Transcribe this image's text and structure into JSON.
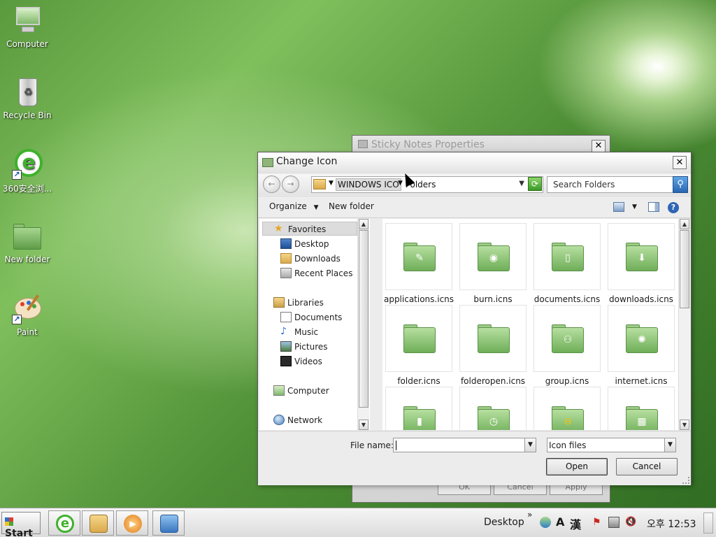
{
  "desktop": {
    "icons": [
      {
        "label": "Computer",
        "icon": "computer-icon"
      },
      {
        "label": "Recycle Bin",
        "icon": "recycle-bin-icon"
      },
      {
        "label": "360安全浏...",
        "icon": "browser-360-icon"
      },
      {
        "label": "New folder",
        "icon": "folder-icon"
      },
      {
        "label": "Paint",
        "icon": "paint-icon"
      }
    ]
  },
  "background_dialog": {
    "title": "Sticky Notes Properties",
    "ok_label": "OK",
    "cancel_label": "Cancel",
    "apply_label": "Apply"
  },
  "dialog": {
    "title": "Change Icon",
    "close_label": "✕",
    "address": {
      "segments": [
        "WINDOWS ICO",
        "Folders"
      ]
    },
    "search": {
      "placeholder": "Search Folders"
    },
    "toolbar": {
      "organize_label": "Organize",
      "new_folder_label": "New folder"
    },
    "nav": {
      "favorites_label": "Favorites",
      "favorites": [
        "Desktop",
        "Downloads",
        "Recent Places"
      ],
      "libraries_label": "Libraries",
      "libraries": [
        "Documents",
        "Music",
        "Pictures",
        "Videos"
      ],
      "computer_label": "Computer",
      "network_label": "Network"
    },
    "files": [
      {
        "name": "applications.icns",
        "glyph": "✎"
      },
      {
        "name": "burn.icns",
        "glyph": "◉"
      },
      {
        "name": "documents.icns",
        "glyph": "▯"
      },
      {
        "name": "downloads.icns",
        "glyph": "⬇"
      },
      {
        "name": "folder.icns",
        "glyph": ""
      },
      {
        "name": "folderopen.icns",
        "glyph": ""
      },
      {
        "name": "group.icns",
        "glyph": "⚇"
      },
      {
        "name": "internet.icns",
        "glyph": "✺"
      },
      {
        "name": "",
        "glyph": "▮"
      },
      {
        "name": "",
        "glyph": "◷"
      },
      {
        "name": "",
        "glyph": "⊖"
      },
      {
        "name": "",
        "glyph": "▦"
      }
    ],
    "file_name_label": "File name:",
    "file_name_value": "",
    "file_type_selected": "Icon files",
    "open_label": "Open",
    "cancel_label": "Cancel"
  },
  "taskbar": {
    "start_label": "Start",
    "desktop_label": "Desktop",
    "chevron": "»",
    "ime_a": "A",
    "ime_han": "漢",
    "clock": "오후 12:53"
  }
}
